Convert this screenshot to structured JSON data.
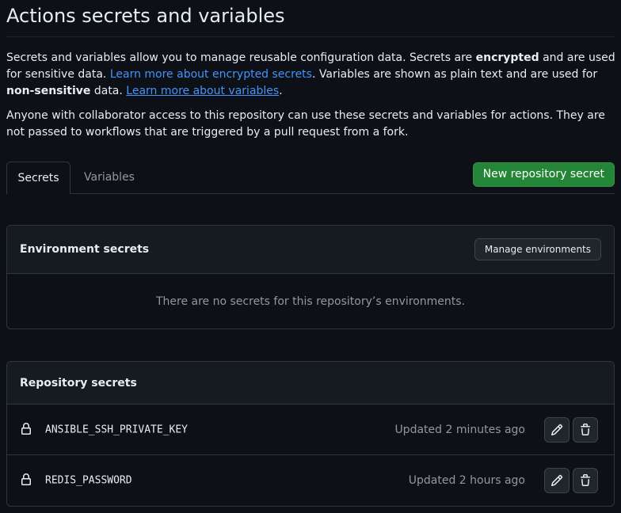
{
  "page": {
    "title": "Actions secrets and variables"
  },
  "intro": {
    "p1_part1": "Secrets and variables allow you to manage reusable configuration data. Secrets are ",
    "p1_bold1": "encrypted",
    "p1_part2": " and are used for sensitive data. ",
    "p1_link1": "Learn more about encrypted secrets",
    "p1_part3": ". Variables are shown as plain text and are used for ",
    "p1_bold2": "non-sensitive",
    "p1_part4": " data. ",
    "p1_link2": "Learn more about variables",
    "p1_part5": ".",
    "p2": "Anyone with collaborator access to this repository can use these secrets and variables for actions. They are not passed to workflows that are triggered by a pull request from a fork."
  },
  "tabs": [
    {
      "label": "Secrets",
      "active": true
    },
    {
      "label": "Variables",
      "active": false
    }
  ],
  "new_secret_button": "New repository secret",
  "environment_secrets": {
    "title": "Environment secrets",
    "manage_button": "Manage environments",
    "empty_message": "There are no secrets for this repository’s environments."
  },
  "repository_secrets": {
    "title": "Repository secrets",
    "items": [
      {
        "name": "ANSIBLE_SSH_PRIVATE_KEY",
        "updated": "Updated 2 minutes ago"
      },
      {
        "name": "REDIS_PASSWORD",
        "updated": "Updated 2 hours ago"
      }
    ]
  },
  "icons": {
    "lock": "lock-icon",
    "edit": "pencil-icon",
    "delete": "trash-icon"
  },
  "colors": {
    "background": "#0d1117",
    "primary_button": "#238636",
    "link": "#4493f8",
    "muted_text": "#9198a1",
    "border": "#30363d"
  }
}
